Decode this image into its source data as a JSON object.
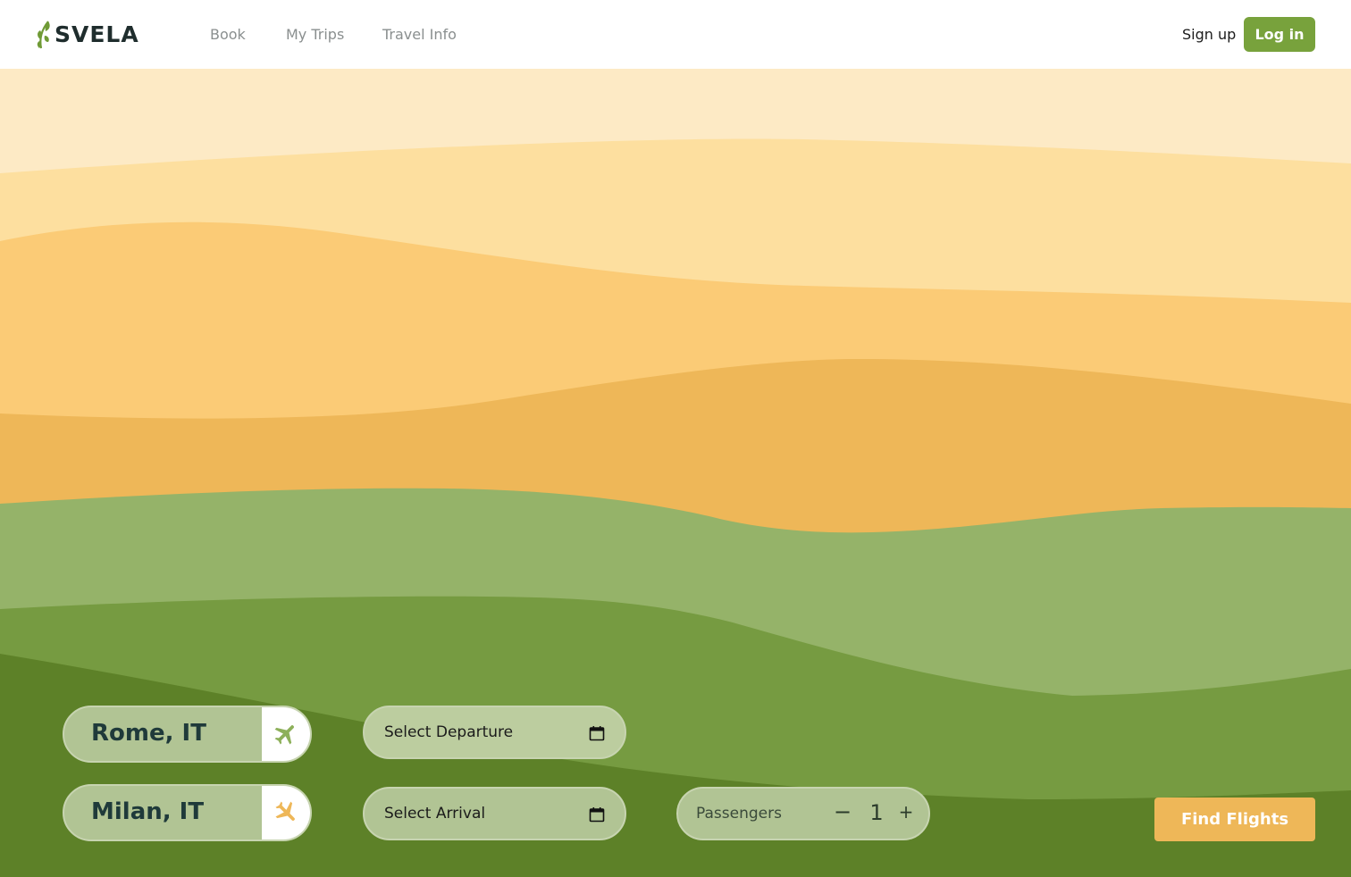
{
  "brand": {
    "name": "SVELA"
  },
  "nav": {
    "items": [
      "Book",
      "My Trips",
      "Travel Info"
    ]
  },
  "auth": {
    "signup_label": "Sign up",
    "login_label": "Log in"
  },
  "search": {
    "from_city": "Rome, IT",
    "to_city": "Milan, IT",
    "departure_label": "Select Departure",
    "arrival_label": "Select Arrival",
    "passengers_label": "Passengers",
    "passengers_minus": "−",
    "passengers_count": "1",
    "passengers_plus": "+",
    "submit_label": "Find Flights"
  },
  "icons": {
    "brand_leaf": "leaf-icon",
    "departure": "plane-takeoff-icon",
    "arrival": "plane-landing-icon",
    "calendar": "calendar-icon"
  },
  "colors": {
    "brand_green": "#78a23c",
    "accent_orange": "#eeb758",
    "layer_1": "#fdeac5",
    "layer_2": "#fddf9f",
    "layer_3": "#fbcb76",
    "layer_4": "#eeb758",
    "layer_5": "#95b369",
    "layer_6": "#769b41",
    "layer_7": "#5d8128"
  }
}
